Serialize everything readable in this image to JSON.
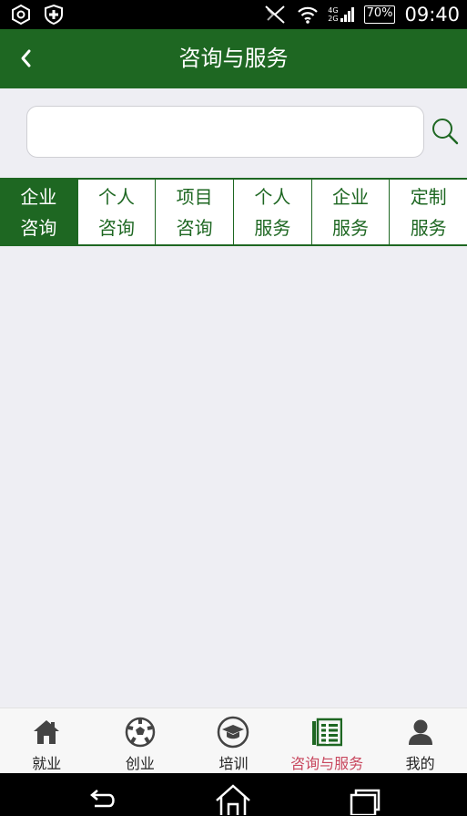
{
  "status_bar": {
    "network_top": "4G",
    "network_bottom": "2G",
    "battery": "70%",
    "time": "09:40"
  },
  "header": {
    "title": "咨询与服务"
  },
  "search": {
    "value": "",
    "placeholder": ""
  },
  "tabs": [
    {
      "line1": "企业",
      "line2": "咨询",
      "active": true
    },
    {
      "line1": "个人",
      "line2": "咨询",
      "active": false
    },
    {
      "line1": "项目",
      "line2": "咨询",
      "active": false
    },
    {
      "line1": "个人",
      "line2": "服务",
      "active": false
    },
    {
      "line1": "企业",
      "line2": "服务",
      "active": false
    },
    {
      "line1": "定制",
      "line2": "服务",
      "active": false
    }
  ],
  "bottom_nav": [
    {
      "label": "就业",
      "icon": "home-icon"
    },
    {
      "label": "创业",
      "icon": "soccer-ball-icon"
    },
    {
      "label": "培训",
      "icon": "graduation-cap-icon"
    },
    {
      "label": "咨询与服务",
      "icon": "list-icon",
      "active": true
    },
    {
      "label": "我的",
      "icon": "user-icon"
    }
  ],
  "colors": {
    "brand_green": "#1e6722",
    "active_nav_label": "#c8475e",
    "background": "#eeeef3"
  }
}
